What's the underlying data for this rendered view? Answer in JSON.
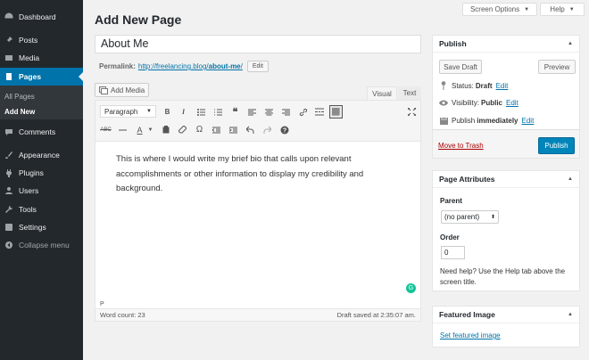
{
  "sidebar": {
    "items": [
      {
        "label": "Dashboard",
        "icon": "dashboard-icon"
      },
      {
        "label": "Posts",
        "icon": "pin-icon"
      },
      {
        "label": "Media",
        "icon": "media-icon"
      },
      {
        "label": "Pages",
        "icon": "pages-icon"
      },
      {
        "label": "Comments",
        "icon": "comments-icon"
      },
      {
        "label": "Appearance",
        "icon": "brush-icon"
      },
      {
        "label": "Plugins",
        "icon": "plugin-icon"
      },
      {
        "label": "Users",
        "icon": "users-icon"
      },
      {
        "label": "Tools",
        "icon": "wrench-icon"
      },
      {
        "label": "Settings",
        "icon": "settings-icon"
      }
    ],
    "submenu": [
      "All Pages",
      "Add New"
    ],
    "collapse_label": "Collapse menu",
    "accent": "#0073aa"
  },
  "header": {
    "screen_options": "Screen Options",
    "help": "Help",
    "title": "Add New Page"
  },
  "post": {
    "title_value": "About Me",
    "permalink_label": "Permalink:",
    "permalink_base": "http://freelancing.blog/",
    "permalink_slug": "about-me",
    "permalink_end": "/",
    "edit_label": "Edit"
  },
  "editor": {
    "add_media": "Add Media",
    "tab_visual": "Visual",
    "tab_text": "Text",
    "format": "Paragraph",
    "content": "This is where I would write my brief bio that calls upon relevant accomplishments or other information to display my credibility and background.",
    "path": "P",
    "word_count": "Word count: 23",
    "draft_saved": "Draft saved at 2:35:07 am."
  },
  "publish": {
    "title": "Publish",
    "save_draft": "Save Draft",
    "preview": "Preview",
    "status_label": "Status:",
    "status_value": "Draft",
    "visibility_label": "Visibility:",
    "visibility_value": "Public",
    "publish_label": "Publish",
    "publish_value": "immediately",
    "edit": "Edit",
    "trash": "Move to Trash",
    "publish_button": "Publish"
  },
  "attributes": {
    "title": "Page Attributes",
    "parent_label": "Parent",
    "parent_value": "(no parent)",
    "order_label": "Order",
    "order_value": "0",
    "help_text": "Need help? Use the Help tab above the screen title."
  },
  "featured": {
    "title": "Featured Image",
    "link": "Set featured image"
  }
}
